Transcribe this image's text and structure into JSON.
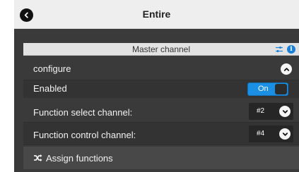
{
  "header": {
    "title": "Entire"
  },
  "panel": {
    "section_title": "Master channel",
    "configure_label": "configure",
    "enabled": {
      "label": "Enabled",
      "toggle_text": "On",
      "state": true
    },
    "function_select": {
      "label": "Function select channel:",
      "value": "#2"
    },
    "function_control": {
      "label": "Function control channel:",
      "value": "#4"
    },
    "assign_label": "Assign functions"
  },
  "colors": {
    "accent": "#1a8fe3",
    "info": "#1a7fd6",
    "panel_bg": "#3a3a3a",
    "header_bg": "#eeeeee"
  },
  "icons": [
    "back-arrow-icon",
    "sliders-icon",
    "info-icon",
    "chevron-up-icon",
    "chevron-down-icon",
    "shuffle-icon"
  ]
}
